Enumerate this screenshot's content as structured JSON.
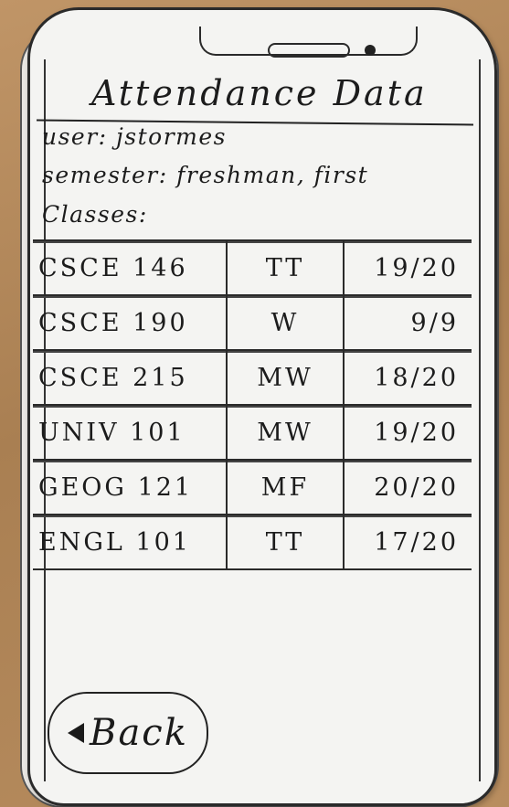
{
  "screen": {
    "title": "Attendance Data"
  },
  "info": {
    "user_line": "user: jstormes",
    "semester_line": "semester: freshman, first",
    "classes_heading": "Classes:"
  },
  "classes": [
    {
      "course": "CSCE 146",
      "days": "TT",
      "attendance": "19/20"
    },
    {
      "course": "CSCE 190",
      "days": "W",
      "attendance": "9/9"
    },
    {
      "course": "CSCE 215",
      "days": "MW",
      "attendance": "18/20"
    },
    {
      "course": "UNIV 101",
      "days": "MW",
      "attendance": "19/20"
    },
    {
      "course": "GEOG 121",
      "days": "MF",
      "attendance": "20/20"
    },
    {
      "course": "ENGL 101",
      "days": "TT",
      "attendance": "17/20"
    }
  ],
  "back_button": {
    "label": "Back",
    "icon": "left-triangle-icon"
  }
}
